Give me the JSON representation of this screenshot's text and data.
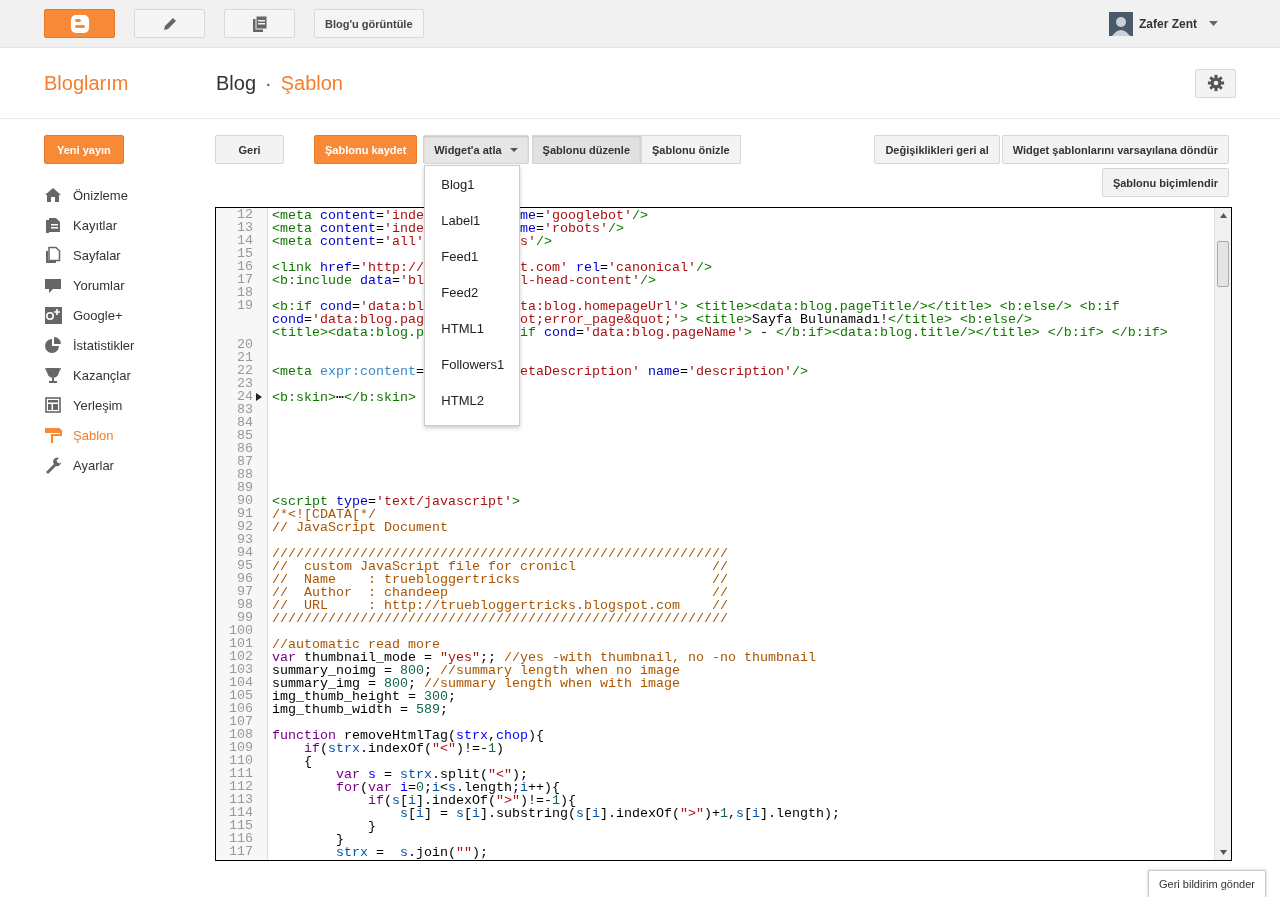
{
  "top_bar": {
    "view_blog_button": "Blog'u görüntüle",
    "user": {
      "name": "Zafer Zent"
    }
  },
  "header": {
    "title": "Bloglarım",
    "blog": "Blog",
    "separator": "·",
    "page": "Şablon"
  },
  "sidebar": {
    "new_post_button": "Yeni yayın",
    "items": [
      {
        "label": "Önizleme",
        "selected": false
      },
      {
        "label": "Kayıtlar",
        "selected": false
      },
      {
        "label": "Sayfalar",
        "selected": false
      },
      {
        "label": "Yorumlar",
        "selected": false
      },
      {
        "label": "Google+",
        "selected": false
      },
      {
        "label": "İstatistikler",
        "selected": false
      },
      {
        "label": "Kazançlar",
        "selected": false
      },
      {
        "label": "Yerleşim",
        "selected": false
      },
      {
        "label": "Şablon",
        "selected": true
      },
      {
        "label": "Ayarlar",
        "selected": false
      }
    ]
  },
  "toolbar": {
    "back_button": "Geri",
    "save_button": "Şablonu kaydet",
    "jump_menu": {
      "label": "Widget'a atla",
      "expanded": true,
      "items": [
        "Blog1",
        "Label1",
        "Feed1",
        "Feed2",
        "HTML1",
        "Followers1",
        "HTML2"
      ]
    },
    "view_tabs": [
      {
        "label": "Şablonu düzenle",
        "selected": true
      },
      {
        "label": "Şablonu önizle",
        "selected": false
      }
    ],
    "revert_button": "Değişiklikleri geri al",
    "reset_widgets_button": "Widget şablonlarını varsayılana döndür",
    "format_button": "Şablonu biçimlendir"
  },
  "editor": {
    "lines": [
      {
        "num": "12",
        "folded": false,
        "rows": [
          [
            [
              {
                "kind": "tag",
                "text": "<meta"
              },
              {
                "kind": "plain",
                "text": " "
              },
              {
                "kind": "attr",
                "text": "content"
              },
              {
                "kind": "plain",
                "text": "="
              },
              {
                "kind": "str",
                "text": "'inde"
              }
            ],
            [
              {
                "kind": "attr",
                "text": "me"
              },
              {
                "kind": "plain",
                "text": "="
              },
              {
                "kind": "str",
                "text": "'googlebot'"
              },
              {
                "kind": "tag",
                "text": "/>"
              }
            ]
          ]
        ]
      },
      {
        "num": "13",
        "folded": false,
        "rows": [
          [
            [
              {
                "kind": "tag",
                "text": "<meta"
              },
              {
                "kind": "plain",
                "text": " "
              },
              {
                "kind": "attr",
                "text": "content"
              },
              {
                "kind": "plain",
                "text": "="
              },
              {
                "kind": "str",
                "text": "'inde"
              }
            ],
            [
              {
                "kind": "attr",
                "text": "me"
              },
              {
                "kind": "plain",
                "text": "="
              },
              {
                "kind": "str",
                "text": "'robots'"
              },
              {
                "kind": "tag",
                "text": "/>"
              }
            ]
          ]
        ]
      },
      {
        "num": "14",
        "folded": false,
        "rows": [
          [
            [
              {
                "kind": "tag",
                "text": "<meta"
              },
              {
                "kind": "plain",
                "text": " "
              },
              {
                "kind": "attr",
                "text": "content"
              },
              {
                "kind": "plain",
                "text": "="
              },
              {
                "kind": "str",
                "text": "'all'"
              }
            ],
            [
              {
                "kind": "str",
                "text": "s'"
              },
              {
                "kind": "tag",
                "text": "/>"
              }
            ]
          ]
        ]
      },
      {
        "num": "15",
        "folded": false
      },
      {
        "num": "16",
        "folded": false,
        "rows": [
          [
            [
              {
                "kind": "tag",
                "text": "<link"
              },
              {
                "kind": "plain",
                "text": " "
              },
              {
                "kind": "attr",
                "text": "href"
              },
              {
                "kind": "plain",
                "text": "="
              },
              {
                "kind": "str",
                "text": "'http://"
              }
            ],
            [
              {
                "kind": "str",
                "text": "t.com'"
              },
              {
                "kind": "plain",
                "text": " "
              },
              {
                "kind": "attr",
                "text": "rel"
              },
              {
                "kind": "plain",
                "text": "="
              },
              {
                "kind": "str",
                "text": "'canonical'"
              },
              {
                "kind": "tag",
                "text": "/>"
              }
            ]
          ]
        ]
      },
      {
        "num": "17",
        "folded": false,
        "rows": [
          [
            [
              {
                "kind": "tag",
                "text": "<b:include"
              },
              {
                "kind": "plain",
                "text": " "
              },
              {
                "kind": "attr",
                "text": "data"
              },
              {
                "kind": "plain",
                "text": "="
              },
              {
                "kind": "str",
                "text": "'bl"
              }
            ],
            [
              {
                "kind": "str",
                "text": "l-head-content'"
              },
              {
                "kind": "tag",
                "text": "/>"
              }
            ]
          ]
        ]
      },
      {
        "num": "18",
        "folded": false
      },
      {
        "num": "19",
        "folded": false,
        "rows": [
          [
            [
              {
                "kind": "tag",
                "text": "<b:if"
              },
              {
                "kind": "plain",
                "text": " "
              },
              {
                "kind": "attr",
                "text": "cond"
              },
              {
                "kind": "plain",
                "text": "="
              },
              {
                "kind": "str",
                "text": "'data:bl"
              }
            ],
            [
              {
                "kind": "str",
                "text": "ta:blog.homepageUrl'"
              },
              {
                "kind": "tag",
                "text": ">"
              },
              {
                "kind": "plain",
                "text": " "
              },
              {
                "kind": "tag",
                "text": "<title><data:blog.pageTitle/></title>"
              },
              {
                "kind": "plain",
                "text": " "
              },
              {
                "kind": "tag",
                "text": "<b:else/>"
              },
              {
                "kind": "plain",
                "text": " "
              },
              {
                "kind": "tag",
                "text": "<b:if"
              }
            ]
          ],
          [
            [
              {
                "kind": "attr",
                "text": "cond"
              },
              {
                "kind": "plain",
                "text": "="
              },
              {
                "kind": "str",
                "text": "'data:blog.pag"
              }
            ],
            [
              {
                "kind": "str",
                "text": "ot;error_page&quot;'"
              },
              {
                "kind": "tag",
                "text": ">"
              },
              {
                "kind": "plain",
                "text": " "
              },
              {
                "kind": "tag",
                "text": "<title>"
              },
              {
                "kind": "plain",
                "text": "Sayfa Bulunamadı!"
              },
              {
                "kind": "tag",
                "text": "</title>"
              },
              {
                "kind": "plain",
                "text": " "
              },
              {
                "kind": "tag",
                "text": "<b:else/>"
              }
            ]
          ],
          [
            [
              {
                "kind": "tag",
                "text": "<title><data:blog.p"
              }
            ],
            [
              {
                "kind": "tag",
                "text": "if"
              },
              {
                "kind": "plain",
                "text": " "
              },
              {
                "kind": "attr",
                "text": "cond"
              },
              {
                "kind": "plain",
                "text": "="
              },
              {
                "kind": "str",
                "text": "'data:blog.pageName'"
              },
              {
                "kind": "tag",
                "text": ">"
              },
              {
                "kind": "plain",
                "text": " - "
              },
              {
                "kind": "tag",
                "text": "</b:if><data:blog.title/></title>"
              },
              {
                "kind": "plain",
                "text": " "
              },
              {
                "kind": "tag",
                "text": "</b:if>"
              },
              {
                "kind": "plain",
                "text": " "
              },
              {
                "kind": "tag",
                "text": "</b:if>"
              }
            ]
          ]
        ]
      },
      {
        "num": "20",
        "folded": false
      },
      {
        "num": "21",
        "folded": false
      },
      {
        "num": "22",
        "folded": false,
        "rows": [
          [
            [
              {
                "kind": "tag",
                "text": "<meta"
              },
              {
                "kind": "plain",
                "text": " "
              },
              {
                "kind": "attr2",
                "text": "expr:content"
              },
              {
                "kind": "plain",
                "text": "="
              }
            ],
            [
              {
                "kind": "str",
                "text": "etaDescription'"
              },
              {
                "kind": "plain",
                "text": " "
              },
              {
                "kind": "attr",
                "text": "name"
              },
              {
                "kind": "plain",
                "text": "="
              },
              {
                "kind": "str",
                "text": "'description'"
              },
              {
                "kind": "tag",
                "text": "/>"
              }
            ]
          ]
        ]
      },
      {
        "num": "23",
        "folded": false
      },
      {
        "num": "24",
        "folded": true,
        "rows": [
          [
            [
              {
                "kind": "tag",
                "text": "<b:skin>"
              },
              {
                "kind": "plain",
                "text": "⋯"
              },
              {
                "kind": "tag",
                "text": "</b:skin>"
              }
            ]
          ]
        ]
      },
      {
        "num": "83",
        "folded": false
      },
      {
        "num": "84",
        "folded": false
      },
      {
        "num": "85",
        "folded": false
      },
      {
        "num": "86",
        "folded": false
      },
      {
        "num": "87",
        "folded": false
      },
      {
        "num": "88",
        "folded": false
      },
      {
        "num": "89",
        "folded": false
      },
      {
        "num": "90",
        "folded": false,
        "rows": [
          [
            [
              {
                "kind": "tag",
                "text": "<script"
              },
              {
                "kind": "plain",
                "text": " "
              },
              {
                "kind": "attr",
                "text": "type"
              },
              {
                "kind": "plain",
                "text": "="
              },
              {
                "kind": "str",
                "text": "'text/javascript'"
              },
              {
                "kind": "tag",
                "text": ">"
              }
            ]
          ]
        ]
      },
      {
        "num": "91",
        "folded": false,
        "rows": [
          [
            [
              {
                "kind": "cmt",
                "text": "/*<![CDATA[*/"
              }
            ]
          ]
        ]
      },
      {
        "num": "92",
        "folded": false,
        "rows": [
          [
            [
              {
                "kind": "cmt",
                "text": "// JavaScript Document"
              }
            ]
          ]
        ]
      },
      {
        "num": "93",
        "folded": false
      },
      {
        "num": "94",
        "folded": false,
        "rows": [
          [
            [
              {
                "kind": "cmt",
                "text": "/////////////////////////////////////////////////////////"
              }
            ]
          ]
        ]
      },
      {
        "num": "95",
        "folded": false,
        "rows": [
          [
            [
              {
                "kind": "cmt",
                "text": "//  custom JavaScript file for cronicl                 //"
              }
            ]
          ]
        ]
      },
      {
        "num": "96",
        "folded": false,
        "rows": [
          [
            [
              {
                "kind": "cmt",
                "text": "//  Name    : truebloggertricks                        //"
              }
            ]
          ]
        ]
      },
      {
        "num": "97",
        "folded": false,
        "rows": [
          [
            [
              {
                "kind": "cmt",
                "text": "//  Author  : chandeep                                 //"
              }
            ]
          ]
        ]
      },
      {
        "num": "98",
        "folded": false,
        "rows": [
          [
            [
              {
                "kind": "cmt",
                "text": "//  URL     : http://truebloggertricks.blogspot.com    //"
              }
            ]
          ]
        ]
      },
      {
        "num": "99",
        "folded": false,
        "rows": [
          [
            [
              {
                "kind": "cmt",
                "text": "/////////////////////////////////////////////////////////"
              }
            ]
          ]
        ]
      },
      {
        "num": "100",
        "folded": false
      },
      {
        "num": "101",
        "folded": false,
        "rows": [
          [
            [
              {
                "kind": "cmt",
                "text": "//automatic read more"
              }
            ]
          ]
        ]
      },
      {
        "num": "102",
        "folded": false,
        "rows": [
          [
            [
              {
                "kind": "kw",
                "text": "var"
              },
              {
                "kind": "plain",
                "text": " thumbnail_mode = "
              },
              {
                "kind": "str",
                "text": "\"yes\""
              },
              {
                "kind": "plain",
                "text": ";; "
              },
              {
                "kind": "cmt",
                "text": "//yes -with thumbnail, no -no thumbnail"
              }
            ]
          ]
        ]
      },
      {
        "num": "103",
        "folded": false,
        "rows": [
          [
            [
              {
                "kind": "plain",
                "text": "summary_noimg = "
              },
              {
                "kind": "num",
                "text": "800"
              },
              {
                "kind": "plain",
                "text": "; "
              },
              {
                "kind": "cmt",
                "text": "//summary length when no image"
              }
            ]
          ]
        ]
      },
      {
        "num": "104",
        "folded": false,
        "rows": [
          [
            [
              {
                "kind": "plain",
                "text": "summary_img = "
              },
              {
                "kind": "num",
                "text": "800"
              },
              {
                "kind": "plain",
                "text": "; "
              },
              {
                "kind": "cmt",
                "text": "//summary length when with image"
              }
            ]
          ]
        ]
      },
      {
        "num": "105",
        "folded": false,
        "rows": [
          [
            [
              {
                "kind": "plain",
                "text": "img_thumb_height = "
              },
              {
                "kind": "num",
                "text": "300"
              },
              {
                "kind": "plain",
                "text": ";"
              }
            ]
          ]
        ]
      },
      {
        "num": "106",
        "folded": false,
        "rows": [
          [
            [
              {
                "kind": "plain",
                "text": "img_thumb_width = "
              },
              {
                "kind": "num",
                "text": "589"
              },
              {
                "kind": "plain",
                "text": ";"
              }
            ]
          ]
        ]
      },
      {
        "num": "107",
        "folded": false
      },
      {
        "num": "108",
        "folded": false,
        "rows": [
          [
            [
              {
                "kind": "kw",
                "text": "function"
              },
              {
                "kind": "plain",
                "text": " removeHtmlTag("
              },
              {
                "kind": "def",
                "text": "strx"
              },
              {
                "kind": "plain",
                "text": ","
              },
              {
                "kind": "def",
                "text": "chop"
              },
              {
                "kind": "plain",
                "text": "){"
              }
            ]
          ]
        ]
      },
      {
        "num": "109",
        "folded": false,
        "rows": [
          [
            [
              {
                "kind": "plain",
                "text": "    "
              },
              {
                "kind": "kw",
                "text": "if"
              },
              {
                "kind": "plain",
                "text": "("
              },
              {
                "kind": "var",
                "text": "strx"
              },
              {
                "kind": "plain",
                "text": ".indexOf("
              },
              {
                "kind": "str",
                "text": "\"<\""
              },
              {
                "kind": "plain",
                "text": ")!=-"
              },
              {
                "kind": "num",
                "text": "1"
              },
              {
                "kind": "plain",
                "text": ")"
              }
            ]
          ]
        ]
      },
      {
        "num": "110",
        "folded": false,
        "rows": [
          [
            [
              {
                "kind": "plain",
                "text": "    {"
              }
            ]
          ]
        ]
      },
      {
        "num": "111",
        "folded": false,
        "rows": [
          [
            [
              {
                "kind": "plain",
                "text": "        "
              },
              {
                "kind": "kw",
                "text": "var"
              },
              {
                "kind": "plain",
                "text": " "
              },
              {
                "kind": "def",
                "text": "s"
              },
              {
                "kind": "plain",
                "text": " = "
              },
              {
                "kind": "var",
                "text": "strx"
              },
              {
                "kind": "plain",
                "text": ".split("
              },
              {
                "kind": "str",
                "text": "\"<\""
              },
              {
                "kind": "plain",
                "text": ");"
              }
            ]
          ]
        ]
      },
      {
        "num": "112",
        "folded": false,
        "rows": [
          [
            [
              {
                "kind": "plain",
                "text": "        "
              },
              {
                "kind": "kw",
                "text": "for"
              },
              {
                "kind": "plain",
                "text": "("
              },
              {
                "kind": "kw",
                "text": "var"
              },
              {
                "kind": "plain",
                "text": " "
              },
              {
                "kind": "def",
                "text": "i"
              },
              {
                "kind": "plain",
                "text": "="
              },
              {
                "kind": "num",
                "text": "0"
              },
              {
                "kind": "plain",
                "text": ";"
              },
              {
                "kind": "var",
                "text": "i"
              },
              {
                "kind": "plain",
                "text": "<"
              },
              {
                "kind": "var",
                "text": "s"
              },
              {
                "kind": "plain",
                "text": ".length;"
              },
              {
                "kind": "var",
                "text": "i"
              },
              {
                "kind": "plain",
                "text": "++){"
              }
            ]
          ]
        ]
      },
      {
        "num": "113",
        "folded": false,
        "rows": [
          [
            [
              {
                "kind": "plain",
                "text": "            "
              },
              {
                "kind": "kw",
                "text": "if"
              },
              {
                "kind": "plain",
                "text": "("
              },
              {
                "kind": "var",
                "text": "s"
              },
              {
                "kind": "plain",
                "text": "["
              },
              {
                "kind": "var",
                "text": "i"
              },
              {
                "kind": "plain",
                "text": "].indexOf("
              },
              {
                "kind": "str",
                "text": "\">\""
              },
              {
                "kind": "plain",
                "text": ")!=-"
              },
              {
                "kind": "num",
                "text": "1"
              },
              {
                "kind": "plain",
                "text": "){"
              }
            ]
          ]
        ]
      },
      {
        "num": "114",
        "folded": false,
        "rows": [
          [
            [
              {
                "kind": "plain",
                "text": "                "
              },
              {
                "kind": "var",
                "text": "s"
              },
              {
                "kind": "plain",
                "text": "["
              },
              {
                "kind": "var",
                "text": "i"
              },
              {
                "kind": "plain",
                "text": "] = "
              },
              {
                "kind": "var",
                "text": "s"
              },
              {
                "kind": "plain",
                "text": "["
              },
              {
                "kind": "var",
                "text": "i"
              },
              {
                "kind": "plain",
                "text": "].substring("
              },
              {
                "kind": "var",
                "text": "s"
              },
              {
                "kind": "plain",
                "text": "["
              },
              {
                "kind": "var",
                "text": "i"
              },
              {
                "kind": "plain",
                "text": "].indexOf("
              },
              {
                "kind": "str",
                "text": "\">\""
              },
              {
                "kind": "plain",
                "text": ")+"
              },
              {
                "kind": "num",
                "text": "1"
              },
              {
                "kind": "plain",
                "text": ","
              },
              {
                "kind": "var",
                "text": "s"
              },
              {
                "kind": "plain",
                "text": "["
              },
              {
                "kind": "var",
                "text": "i"
              },
              {
                "kind": "plain",
                "text": "].length);"
              }
            ]
          ]
        ]
      },
      {
        "num": "115",
        "folded": false,
        "rows": [
          [
            [
              {
                "kind": "plain",
                "text": "            }"
              }
            ]
          ]
        ]
      },
      {
        "num": "116",
        "folded": false,
        "rows": [
          [
            [
              {
                "kind": "plain",
                "text": "        }"
              }
            ]
          ]
        ]
      },
      {
        "num": "117",
        "folded": false,
        "rows": [
          [
            [
              {
                "kind": "plain",
                "text": "        "
              },
              {
                "kind": "var",
                "text": "strx"
              },
              {
                "kind": "plain",
                "text": " =  "
              },
              {
                "kind": "var",
                "text": "s"
              },
              {
                "kind": "plain",
                "text": ".join("
              },
              {
                "kind": "str",
                "text": "\"\""
              },
              {
                "kind": "plain",
                "text": ");"
              }
            ]
          ]
        ]
      }
    ]
  },
  "feedback_button": "Geri bildirim gönder"
}
